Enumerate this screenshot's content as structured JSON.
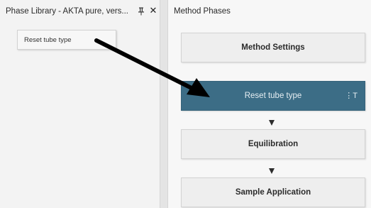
{
  "left_panel": {
    "title": "Phase Library - AKTA pure, vers...",
    "pin_icon": "pin-icon",
    "close_label": "✕",
    "items": [
      {
        "label": "Reset tube type"
      }
    ]
  },
  "right_panel": {
    "title": "Method Phases",
    "phases": [
      {
        "label": "Method Settings"
      },
      {
        "label": "Reset tube type",
        "handle": "⋮T",
        "selected": true
      },
      {
        "label": "Equilibration"
      },
      {
        "label": "Sample Application"
      }
    ]
  },
  "colors": {
    "selected_phase": "#3c6d86",
    "phase_bg": "#eeeeee",
    "annotation_arrow": "#000000"
  }
}
